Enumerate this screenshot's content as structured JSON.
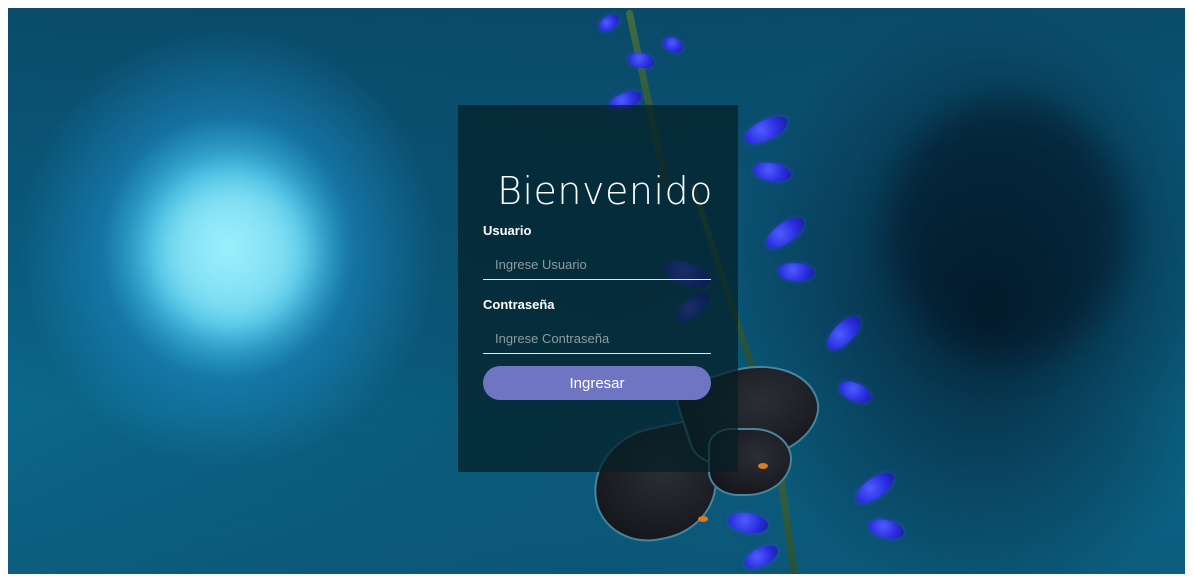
{
  "login": {
    "title": "Bienvenido",
    "username": {
      "label": "Usuario",
      "placeholder": "Ingrese Usuario",
      "value": ""
    },
    "password": {
      "label": "Contraseña",
      "placeholder": "Ingrese Contraseña",
      "value": ""
    },
    "submit_label": "Ingresar"
  },
  "colors": {
    "panel_background": "rgba(4, 30, 38, 0.72)",
    "button": "#6f75c2",
    "text": "#ffffff",
    "placeholder": "#8e9ca1"
  }
}
